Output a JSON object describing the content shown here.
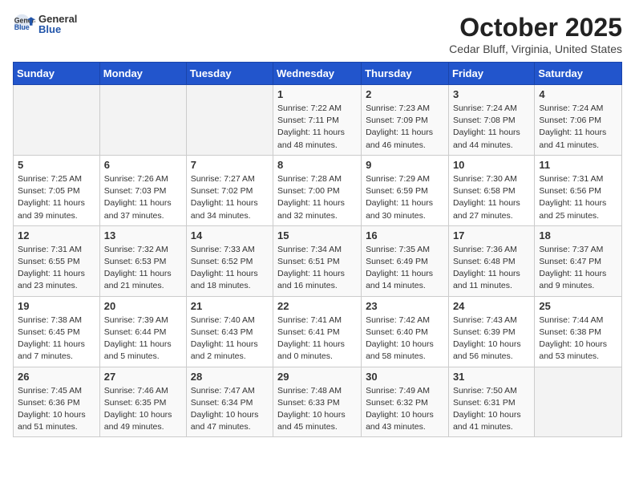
{
  "header": {
    "logo_general": "General",
    "logo_blue": "Blue",
    "month": "October 2025",
    "location": "Cedar Bluff, Virginia, United States"
  },
  "columns": [
    "Sunday",
    "Monday",
    "Tuesday",
    "Wednesday",
    "Thursday",
    "Friday",
    "Saturday"
  ],
  "weeks": [
    [
      {
        "day": "",
        "info": ""
      },
      {
        "day": "",
        "info": ""
      },
      {
        "day": "",
        "info": ""
      },
      {
        "day": "1",
        "info": "Sunrise: 7:22 AM\nSunset: 7:11 PM\nDaylight: 11 hours and 48 minutes."
      },
      {
        "day": "2",
        "info": "Sunrise: 7:23 AM\nSunset: 7:09 PM\nDaylight: 11 hours and 46 minutes."
      },
      {
        "day": "3",
        "info": "Sunrise: 7:24 AM\nSunset: 7:08 PM\nDaylight: 11 hours and 44 minutes."
      },
      {
        "day": "4",
        "info": "Sunrise: 7:24 AM\nSunset: 7:06 PM\nDaylight: 11 hours and 41 minutes."
      }
    ],
    [
      {
        "day": "5",
        "info": "Sunrise: 7:25 AM\nSunset: 7:05 PM\nDaylight: 11 hours and 39 minutes."
      },
      {
        "day": "6",
        "info": "Sunrise: 7:26 AM\nSunset: 7:03 PM\nDaylight: 11 hours and 37 minutes."
      },
      {
        "day": "7",
        "info": "Sunrise: 7:27 AM\nSunset: 7:02 PM\nDaylight: 11 hours and 34 minutes."
      },
      {
        "day": "8",
        "info": "Sunrise: 7:28 AM\nSunset: 7:00 PM\nDaylight: 11 hours and 32 minutes."
      },
      {
        "day": "9",
        "info": "Sunrise: 7:29 AM\nSunset: 6:59 PM\nDaylight: 11 hours and 30 minutes."
      },
      {
        "day": "10",
        "info": "Sunrise: 7:30 AM\nSunset: 6:58 PM\nDaylight: 11 hours and 27 minutes."
      },
      {
        "day": "11",
        "info": "Sunrise: 7:31 AM\nSunset: 6:56 PM\nDaylight: 11 hours and 25 minutes."
      }
    ],
    [
      {
        "day": "12",
        "info": "Sunrise: 7:31 AM\nSunset: 6:55 PM\nDaylight: 11 hours and 23 minutes."
      },
      {
        "day": "13",
        "info": "Sunrise: 7:32 AM\nSunset: 6:53 PM\nDaylight: 11 hours and 21 minutes."
      },
      {
        "day": "14",
        "info": "Sunrise: 7:33 AM\nSunset: 6:52 PM\nDaylight: 11 hours and 18 minutes."
      },
      {
        "day": "15",
        "info": "Sunrise: 7:34 AM\nSunset: 6:51 PM\nDaylight: 11 hours and 16 minutes."
      },
      {
        "day": "16",
        "info": "Sunrise: 7:35 AM\nSunset: 6:49 PM\nDaylight: 11 hours and 14 minutes."
      },
      {
        "day": "17",
        "info": "Sunrise: 7:36 AM\nSunset: 6:48 PM\nDaylight: 11 hours and 11 minutes."
      },
      {
        "day": "18",
        "info": "Sunrise: 7:37 AM\nSunset: 6:47 PM\nDaylight: 11 hours and 9 minutes."
      }
    ],
    [
      {
        "day": "19",
        "info": "Sunrise: 7:38 AM\nSunset: 6:45 PM\nDaylight: 11 hours and 7 minutes."
      },
      {
        "day": "20",
        "info": "Sunrise: 7:39 AM\nSunset: 6:44 PM\nDaylight: 11 hours and 5 minutes."
      },
      {
        "day": "21",
        "info": "Sunrise: 7:40 AM\nSunset: 6:43 PM\nDaylight: 11 hours and 2 minutes."
      },
      {
        "day": "22",
        "info": "Sunrise: 7:41 AM\nSunset: 6:41 PM\nDaylight: 11 hours and 0 minutes."
      },
      {
        "day": "23",
        "info": "Sunrise: 7:42 AM\nSunset: 6:40 PM\nDaylight: 10 hours and 58 minutes."
      },
      {
        "day": "24",
        "info": "Sunrise: 7:43 AM\nSunset: 6:39 PM\nDaylight: 10 hours and 56 minutes."
      },
      {
        "day": "25",
        "info": "Sunrise: 7:44 AM\nSunset: 6:38 PM\nDaylight: 10 hours and 53 minutes."
      }
    ],
    [
      {
        "day": "26",
        "info": "Sunrise: 7:45 AM\nSunset: 6:36 PM\nDaylight: 10 hours and 51 minutes."
      },
      {
        "day": "27",
        "info": "Sunrise: 7:46 AM\nSunset: 6:35 PM\nDaylight: 10 hours and 49 minutes."
      },
      {
        "day": "28",
        "info": "Sunrise: 7:47 AM\nSunset: 6:34 PM\nDaylight: 10 hours and 47 minutes."
      },
      {
        "day": "29",
        "info": "Sunrise: 7:48 AM\nSunset: 6:33 PM\nDaylight: 10 hours and 45 minutes."
      },
      {
        "day": "30",
        "info": "Sunrise: 7:49 AM\nSunset: 6:32 PM\nDaylight: 10 hours and 43 minutes."
      },
      {
        "day": "31",
        "info": "Sunrise: 7:50 AM\nSunset: 6:31 PM\nDaylight: 10 hours and 41 minutes."
      },
      {
        "day": "",
        "info": ""
      }
    ]
  ]
}
